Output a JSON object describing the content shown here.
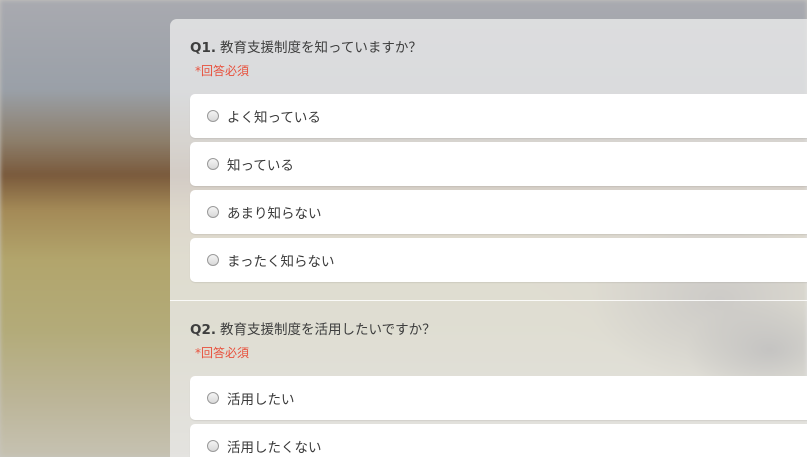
{
  "survey": {
    "required_label": "*回答必須",
    "questions": [
      {
        "number": "Q1.",
        "text": "教育支援制度を知っていますか？",
        "options": [
          {
            "label": "よく知っている"
          },
          {
            "label": "知っている"
          },
          {
            "label": "あまり知らない"
          },
          {
            "label": "まったく知らない"
          }
        ]
      },
      {
        "number": "Q2.",
        "text": "教育支援制度を活用したいですか？",
        "options": [
          {
            "label": "活用したい"
          },
          {
            "label": "活用したくない"
          }
        ]
      }
    ]
  },
  "colors": {
    "required": "#e8503c",
    "question_text": "#3e3e3e",
    "option_background": "#ffffff",
    "panel_background": "rgba(236,236,236,0.78)"
  }
}
